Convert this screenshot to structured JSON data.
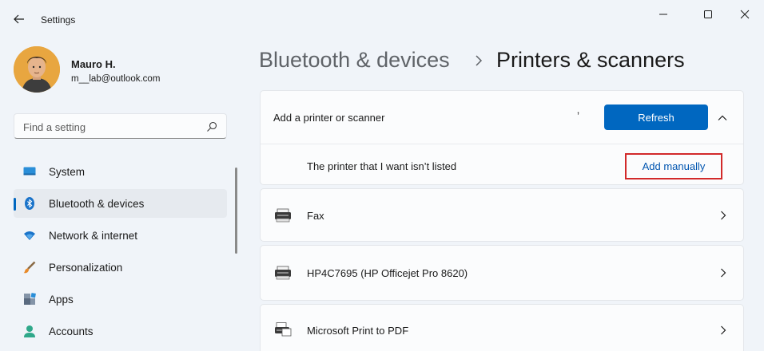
{
  "window": {
    "app_title": "Settings",
    "controls": [
      "minimize",
      "maximize",
      "close"
    ]
  },
  "user": {
    "name": "Mauro H.",
    "email": "m__lab@outlook.com"
  },
  "search": {
    "placeholder": "Find a setting"
  },
  "sidebar": {
    "items": [
      {
        "label": "System",
        "icon": "system-icon",
        "active": false
      },
      {
        "label": "Bluetooth & devices",
        "icon": "bluetooth-icon",
        "active": true
      },
      {
        "label": "Network & internet",
        "icon": "wifi-icon",
        "active": false
      },
      {
        "label": "Personalization",
        "icon": "brush-icon",
        "active": false
      },
      {
        "label": "Apps",
        "icon": "apps-icon",
        "active": false
      },
      {
        "label": "Accounts",
        "icon": "person-icon",
        "active": false
      }
    ]
  },
  "breadcrumb": {
    "parent": "Bluetooth & devices",
    "current": "Printers & scanners"
  },
  "add_printer": {
    "label": "Add a printer or scanner",
    "refresh_label": "Refresh",
    "not_listed_label": "The printer that I want isn’t listed",
    "add_manually_label": "Add manually"
  },
  "printers": [
    {
      "name": "Fax",
      "icon": "fax-printer-icon"
    },
    {
      "name": "HP4C7695 (HP Officejet Pro 8620)",
      "icon": "printer-icon"
    },
    {
      "name": "Microsoft Print to PDF",
      "icon": "pdf-printer-icon"
    }
  ],
  "colors": {
    "accent": "#0067c0",
    "highlight_box": "#d22a2a",
    "background": "#f0f4f9"
  }
}
